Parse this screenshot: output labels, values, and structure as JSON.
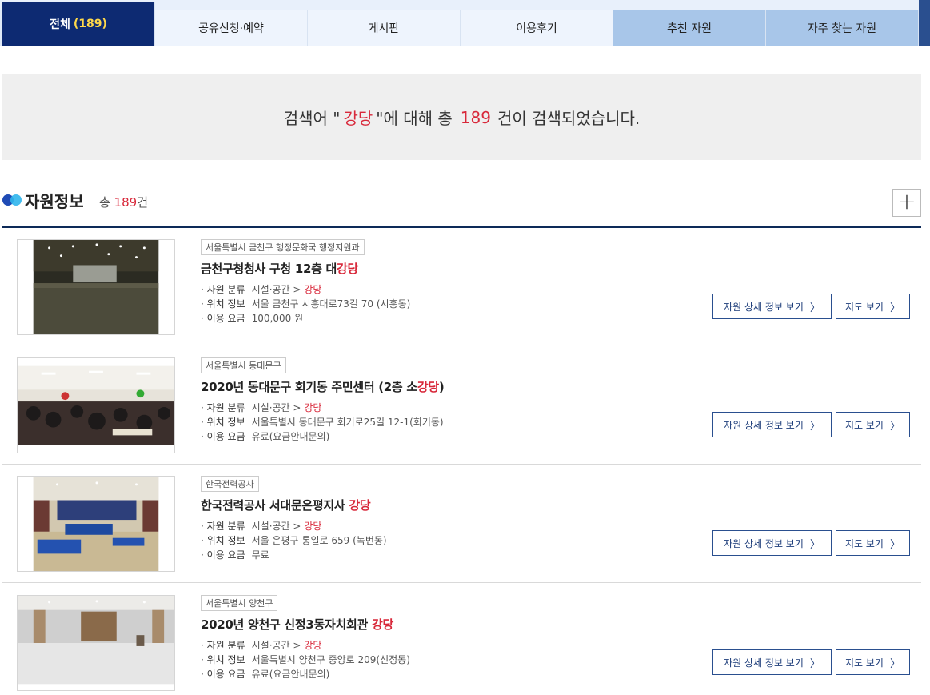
{
  "tabs": [
    {
      "label": "전체",
      "count": "(189)"
    },
    {
      "label": "공유신청·예약"
    },
    {
      "label": "게시판"
    },
    {
      "label": "이용후기"
    },
    {
      "label": "추천 자원"
    },
    {
      "label": "자주 찾는 자원"
    }
  ],
  "summary": {
    "prefix": "검색어 \"",
    "keyword": "강당",
    "middle": "\"에 대해 총",
    "count": "189",
    "suffix": "건이 검색되었습니다."
  },
  "section": {
    "title": "자원정보",
    "total_prefix": "총",
    "total_count": "189",
    "total_suffix": "건",
    "expand_label": "+"
  },
  "labels": {
    "category": "자원 분류",
    "location": "위치 정보",
    "fee": "이용 요금",
    "detail_button": "자원 상세 정보 보기",
    "map_button": "지도 보기",
    "chevron": "〉"
  },
  "results": [
    {
      "org": "서울특별시 금천구 행정문화국 행정지원과",
      "title_main": "금천구청청사 구청 12층 대",
      "title_hl": "강당",
      "title_tail": "",
      "category_main": "시설·공간 >",
      "category_hl": "강당",
      "location": "서울 금천구 시흥대로73길 70 (시흥동)",
      "fee": "100,000 원"
    },
    {
      "org": "서울특별시 동대문구",
      "title_main": "2020년 동대문구 회기동 주민센터 (2층 소",
      "title_hl": "강당",
      "title_tail": ")",
      "category_main": "시설·공간 >",
      "category_hl": "강당",
      "location": "서울특별시 동대문구 회기로25길 12-1(회기동)",
      "fee": "유료(요금안내문의)"
    },
    {
      "org": "한국전력공사",
      "title_main": "한국전력공사 서대문은평지사 ",
      "title_hl": "강당",
      "title_tail": "",
      "category_main": "시설·공간 >",
      "category_hl": "강당",
      "location": "서울 은평구 통일로 659 (녹번동)",
      "fee": "무료"
    },
    {
      "org": "서울특별시 양천구",
      "title_main": "2020년 양천구 신정3동자치회관 ",
      "title_hl": "강당",
      "title_tail": "",
      "category_main": "시설·공간 >",
      "category_hl": "강당",
      "location": "서울특별시 양천구 중앙로 209(신정동)",
      "fee": "유료(요금안내문의)"
    }
  ]
}
